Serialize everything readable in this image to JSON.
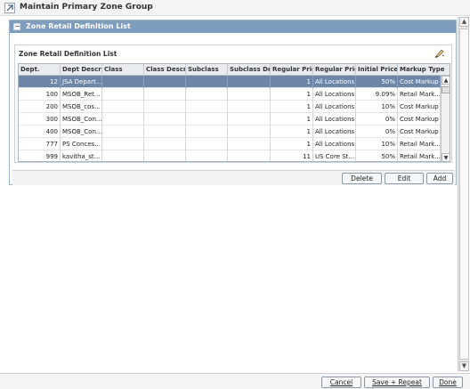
{
  "window": {
    "title": "Maintain Primary Zone Group"
  },
  "section": {
    "title": "Zone Retail Definition List"
  },
  "table": {
    "title": "Zone Retail Definition List",
    "columns": [
      "Dept.",
      "Dept Description",
      "Class",
      "Class Description",
      "Subclass",
      "Subclass Description",
      "Regular Price",
      "Regular Price",
      "Initial Price %",
      "Markup Type"
    ],
    "rows": [
      [
        "12",
        "JSA Depart...",
        "",
        "",
        "",
        "",
        "1",
        "All Locations",
        "50%",
        "Cost Markup"
      ],
      [
        "100",
        "MSOB_Ret...",
        "",
        "",
        "",
        "",
        "1",
        "All Locations",
        "9.09%",
        "Retail Mark..."
      ],
      [
        "200",
        "MSOB_cos...",
        "",
        "",
        "",
        "",
        "1",
        "All Locations",
        "10%",
        "Cost Markup"
      ],
      [
        "300",
        "MSOB_Con...",
        "",
        "",
        "",
        "",
        "1",
        "All Locations",
        "0%",
        "Cost Markup"
      ],
      [
        "400",
        "MSOB_Con...",
        "",
        "",
        "",
        "",
        "1",
        "All Locations",
        "0%",
        "Cost Markup"
      ],
      [
        "777",
        "PS Conces...",
        "",
        "",
        "",
        "",
        "1",
        "All Locations",
        "10%",
        "Retail Mark..."
      ],
      [
        "999",
        "kavitha_st...",
        "",
        "",
        "",
        "",
        "11",
        "US Core St...",
        "50%",
        "Retail Mark..."
      ]
    ]
  },
  "buttons": {
    "delete": "Delete",
    "edit": "Edit",
    "add": "Add"
  },
  "footer": {
    "cancel": "Cancel",
    "save_repeat": "Save + Repeat",
    "done": "Done"
  }
}
